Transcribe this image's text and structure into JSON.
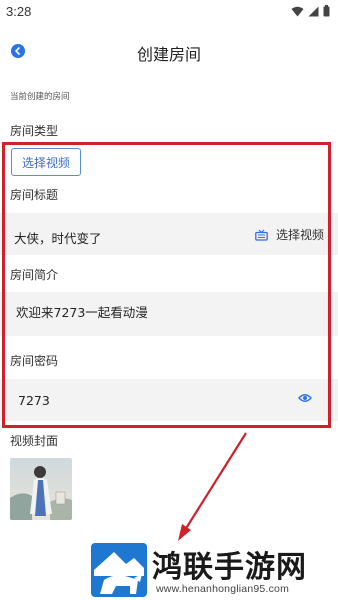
{
  "status_bar": {
    "time": "3:28"
  },
  "header": {
    "title": "创建房间"
  },
  "section_caption": "当前创建的房间",
  "room_type": {
    "label": "房间类型",
    "button": "选择视频"
  },
  "room_title": {
    "label": "房间标题",
    "value": "大侠，时代变了",
    "action_label": "选择视频"
  },
  "room_intro": {
    "label": "房间简介",
    "value": "欢迎来7273一起看动漫"
  },
  "room_password": {
    "label": "房间密码",
    "value": "7273"
  },
  "video_cover": {
    "label": "视频封面"
  },
  "watermark": {
    "brand": "鸿联手游网",
    "url": "www.henanhonglian95.com"
  },
  "colors": {
    "accent": "#2a72e6",
    "highlight": "#d0202a",
    "field_bg": "#f3f3f3"
  }
}
